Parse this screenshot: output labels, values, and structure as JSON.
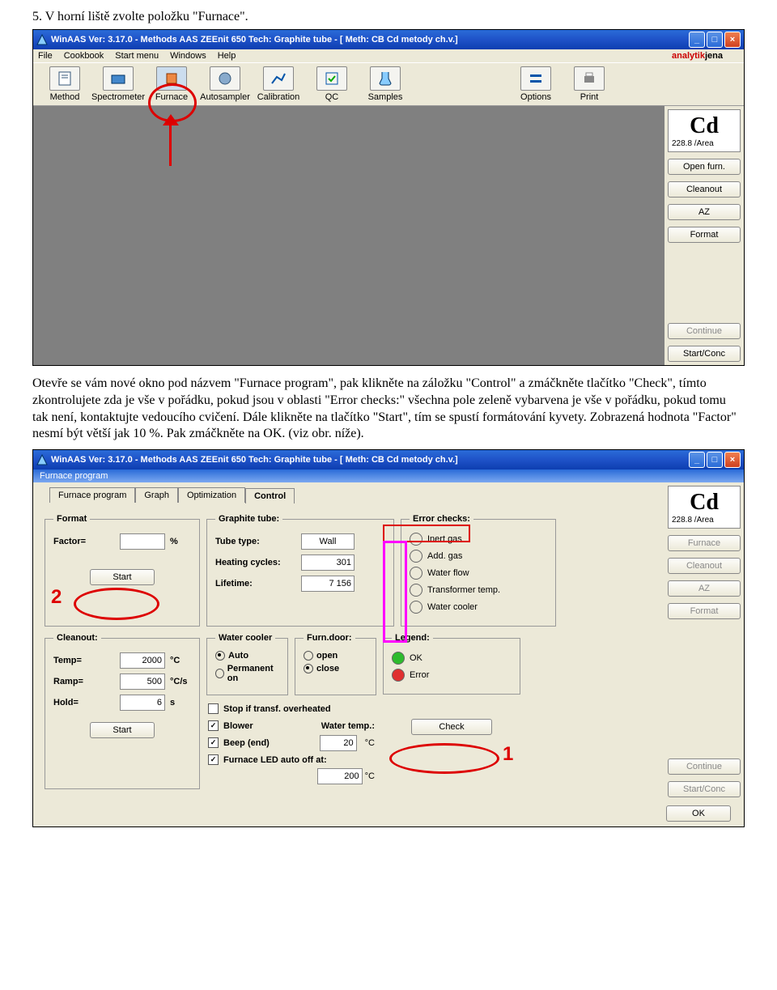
{
  "instruction_5": "5. V horní liště zvolte položku \"Furnace\".",
  "paragraph": "Otevře se vám nové okno pod názvem \"Furnace program\", pak klikněte na záložku \"Control\" a zmáčkněte tlačítko \"Check\", tímto zkontrolujete zda je vše v pořádku, pokud jsou v oblasti \"Error checks:\" všechna pole zeleně vybarvena je vše v pořádku, pokud tomu tak není, kontaktujte vedoucího cvičení. Dále klikněte na tlačítko \"Start\", tím se spustí formátování kyvety. Zobrazená hodnota \"Factor\" nesmí být větší jak 10 %. Pak zmáčkněte na OK. (viz obr. níže).",
  "win": {
    "title": "WinAAS Ver:  3.17.0  -  Methods    AAS ZEEnit 650 Tech: Graphite tube - [ Meth: CB Cd metody ch.v.]",
    "menus": [
      "File",
      "Cookbook",
      "Start menu",
      "Windows",
      "Help"
    ],
    "brand_a": "analytik",
    "brand_b": "jena",
    "toolbar": [
      "Method",
      "Spectrometer",
      "Furnace",
      "Autosampler",
      "Calibration",
      "QC",
      "Samples",
      "Options",
      "Print"
    ],
    "element": {
      "symbol": "Cd",
      "meta": "228.8 /Area"
    },
    "side": {
      "open": "Open furn.",
      "clean": "Cleanout",
      "az": "AZ",
      "format": "Format",
      "cont": "Continue",
      "start": "Start/Conc"
    }
  },
  "ss2": {
    "panel_title": "Furnace program",
    "tabs": [
      "Furnace program",
      "Graph",
      "Optimization",
      "Control"
    ],
    "format": {
      "legend": "Format",
      "factor_lbl": "Factor=",
      "factor_val": "",
      "pct": "%",
      "start": "Start"
    },
    "graphite": {
      "legend": "Graphite tube:",
      "type_lbl": "Tube type:",
      "type_val": "Wall",
      "cycles_lbl": "Heating cycles:",
      "cycles_val": "301",
      "life_lbl": "Lifetime:",
      "life_val": "7 156"
    },
    "errors": {
      "legend": "Error checks:",
      "items": [
        "Inert gas",
        "Add. gas",
        "Water flow",
        "Transformer temp.",
        "Water cooler"
      ]
    },
    "cleanout": {
      "legend": "Cleanout:",
      "temp_lbl": "Temp=",
      "temp_val": "2000",
      "temp_unit": "°C",
      "ramp_lbl": "Ramp=",
      "ramp_val": "500",
      "ramp_unit": "°C/s",
      "hold_lbl": "Hold=",
      "hold_val": "6",
      "hold_unit": "s",
      "start": "Start"
    },
    "cooler": {
      "legend": "Water cooler",
      "auto": "Auto",
      "perm": "Permanent on"
    },
    "door": {
      "legend": "Furn.door:",
      "open": "open",
      "close": "close"
    },
    "misc": {
      "stop": "Stop if transf. overheated",
      "blower": "Blower",
      "beep": "Beep (end)",
      "led": "Furnace LED auto off at:",
      "wt_lbl": "Water temp.:",
      "wt_val": "20",
      "wt_unit": "°C",
      "off_val": "200",
      "off_unit": "°C"
    },
    "legend": {
      "legend": "Legend:",
      "ok": "OK",
      "err": "Error"
    },
    "check": "Check",
    "side": {
      "furn": "Furnace",
      "clean": "Cleanout",
      "az": "AZ",
      "format": "Format",
      "cont": "Continue",
      "start": "Start/Conc"
    },
    "ok": "OK"
  }
}
